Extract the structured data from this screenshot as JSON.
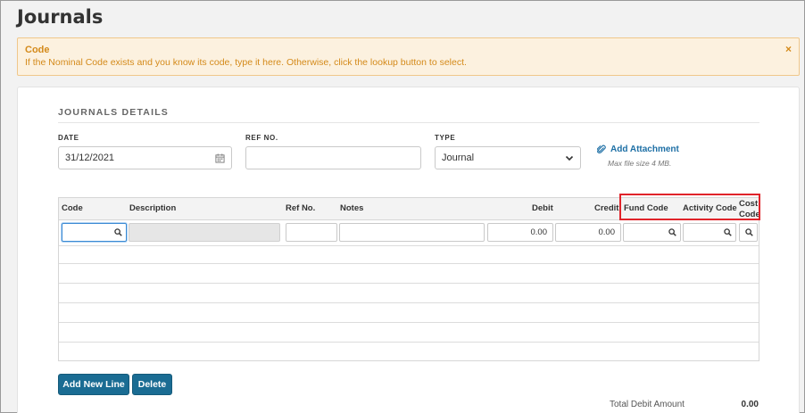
{
  "page": {
    "title": "Journals"
  },
  "alert": {
    "title": "Code",
    "message": "If the Nominal Code exists and you know its code, type it here. Otherwise, click the lookup button to select.",
    "close_label": "×"
  },
  "form": {
    "section_title": "JOURNALS DETAILS",
    "date": {
      "label": "DATE",
      "value": "31/12/2021"
    },
    "ref_no": {
      "label": "REF NO.",
      "value": ""
    },
    "type": {
      "label": "TYPE",
      "value": "Journal"
    },
    "attachment": {
      "label": "Add Attachment",
      "note": "Max file size 4 MB."
    }
  },
  "grid": {
    "columns": {
      "code": "Code",
      "description": "Description",
      "ref_no": "Ref No.",
      "notes": "Notes",
      "debit": "Debit",
      "credit": "Credit",
      "fund_code": "Fund Code",
      "activity_code": "Activity Code",
      "cost_code_1": "Cost",
      "cost_code_2": "Code"
    },
    "row": {
      "code": "",
      "description": "",
      "ref_no": "",
      "notes": "",
      "debit": "0.00",
      "credit": "0.00",
      "fund_code": "",
      "activity_code": "",
      "cost_code": ""
    }
  },
  "actions": {
    "add_new_line": "Add New Line",
    "delete": "Delete"
  },
  "totals": {
    "debit_label": "Total Debit Amount",
    "debit_value": "0.00"
  },
  "colors": {
    "accent": "#1a6c93",
    "link": "#1d6fa5",
    "alert_text": "#d48a1a",
    "highlight": "#e0232a"
  }
}
